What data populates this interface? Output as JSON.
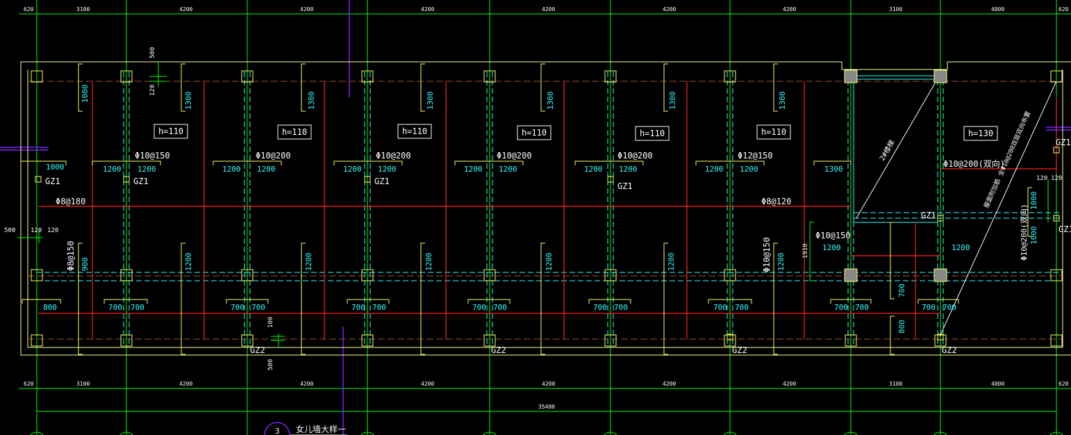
{
  "dims": {
    "top": [
      "620",
      "3100",
      "4200",
      "4200",
      "4200",
      "4200",
      "4200",
      "4200",
      "3100",
      "4000",
      "620"
    ],
    "bottom": [
      "620",
      "3100",
      "4200",
      "4200",
      "4200",
      "4200",
      "4200",
      "4200",
      "3100",
      "4000",
      "620"
    ],
    "total": "35480",
    "left_500": "500",
    "left_120a": "120",
    "left_120b": "120",
    "top_500": "500",
    "top_120": "120",
    "right_120a": "120",
    "right_120b": "120",
    "right_1910": "1910",
    "bottom_100": "100",
    "bottom_500": "500"
  },
  "thickness": [
    "h=110",
    "h=110",
    "h=110",
    "h=110",
    "h=110",
    "h=110",
    "h=130"
  ],
  "rebar": {
    "top_row": [
      "Φ10@150",
      "Φ10@200",
      "Φ10@200",
      "Φ10@200",
      "Φ10@200",
      "Φ12@150"
    ],
    "left_dist": "Φ8@180",
    "right_dist": "Φ8@120",
    "left_vert": "Φ8@150",
    "mid_vert": "Φ10@150",
    "mid_right": "Φ10@150",
    "right_top": "Φ10@200(双向)",
    "right_side": "Φ10@200(双向)"
  },
  "lengths": {
    "upper_short": [
      "1000",
      "1300",
      "1300",
      "1300",
      "1300",
      "1300",
      "1300"
    ],
    "upper_pairs": [
      "1000",
      "1200",
      "1200",
      "1200",
      "1200",
      "1200",
      "1200",
      "1200",
      "1200",
      "1200",
      "1200",
      "1200",
      "1200",
      "1300"
    ],
    "lower_vert": [
      "900",
      "1200",
      "1200",
      "1200",
      "1200",
      "1200",
      "1200"
    ],
    "lower_pairs": [
      "800",
      "700",
      "700",
      "700",
      "700",
      "700",
      "700",
      "700",
      "700",
      "700",
      "700",
      "700",
      "700",
      "700",
      "700",
      "700",
      "700"
    ],
    "mid_1200a": "1200",
    "mid_1200b": "1200",
    "right_1000a": "1000",
    "right_1000b": "1000",
    "right_700": "700",
    "right_800": "800"
  },
  "columns": {
    "gz1": [
      "GZ1",
      "GZ1",
      "GZ1",
      "GZ1",
      "GZ1",
      "GZ1",
      "GZ1"
    ],
    "gz2": [
      "GZ2",
      "GZ2",
      "GZ2",
      "GZ2"
    ]
  },
  "notes": {
    "stair": "2#楼梯",
    "diag": "屋面附加筋 全Φ10@200双层双向布置"
  },
  "detail": {
    "number": "3",
    "title": "女儿墙大样一"
  },
  "colors": {
    "grid": "#00ff00",
    "outline": "#ffff66",
    "rebar": "#ff2020",
    "cyan": "#33ffff",
    "white": "#ffffff",
    "purple": "#7a22ff",
    "column_fill": "#888888"
  }
}
